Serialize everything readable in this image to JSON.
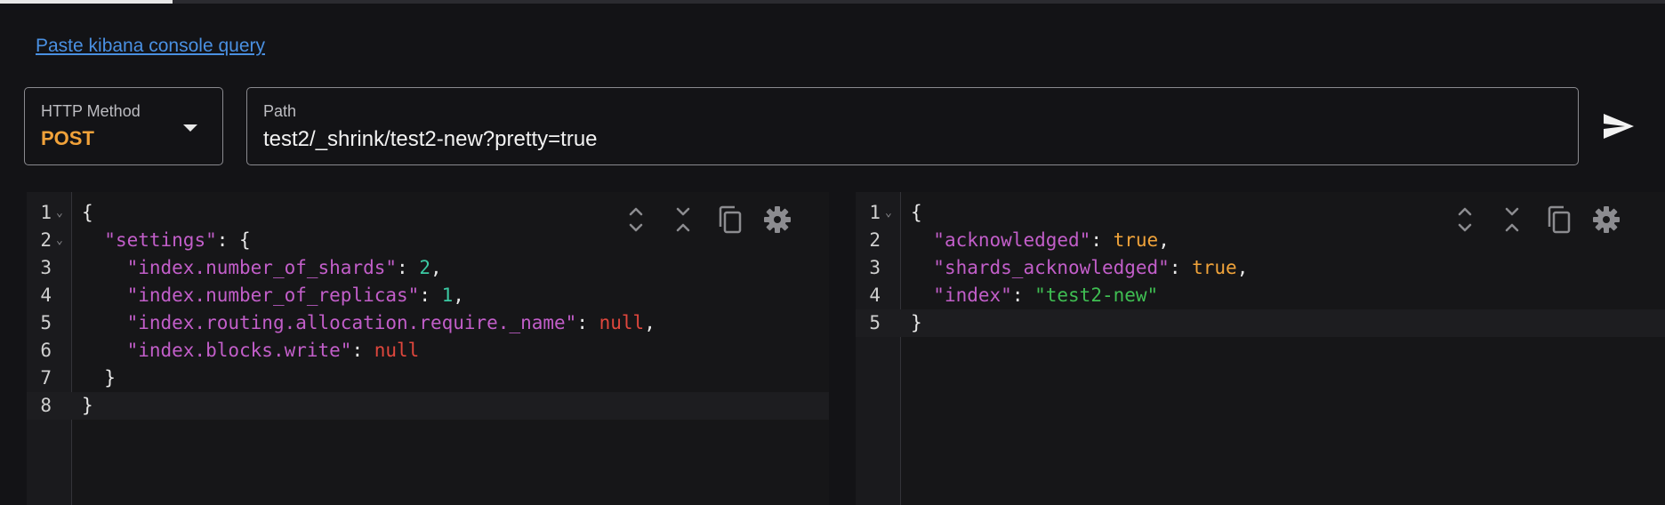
{
  "link": {
    "paste_label": "Paste kibana console query"
  },
  "method": {
    "label": "HTTP Method",
    "value": "POST"
  },
  "path": {
    "label": "Path",
    "value": "test2/_shrink/test2-new?pretty=true"
  },
  "icons": {
    "send": "send-icon",
    "expand": "expand-all-icon",
    "collapse": "collapse-all-icon",
    "copy": "copy-icon",
    "settings": "gear-icon"
  },
  "request": {
    "line_numbers": [
      "1",
      "2",
      "3",
      "4",
      "5",
      "6",
      "7",
      "8"
    ],
    "lines": [
      [
        {
          "t": "{",
          "c": "p"
        }
      ],
      [
        {
          "t": "  ",
          "c": "p"
        },
        {
          "t": "\"settings\"",
          "c": "k"
        },
        {
          "t": ": {",
          "c": "p"
        }
      ],
      [
        {
          "t": "    ",
          "c": "p"
        },
        {
          "t": "\"index.number_of_shards\"",
          "c": "k"
        },
        {
          "t": ": ",
          "c": "p"
        },
        {
          "t": "2",
          "c": "n"
        },
        {
          "t": ",",
          "c": "p"
        }
      ],
      [
        {
          "t": "    ",
          "c": "p"
        },
        {
          "t": "\"index.number_of_replicas\"",
          "c": "k"
        },
        {
          "t": ": ",
          "c": "p"
        },
        {
          "t": "1",
          "c": "n"
        },
        {
          "t": ",",
          "c": "p"
        }
      ],
      [
        {
          "t": "    ",
          "c": "p"
        },
        {
          "t": "\"index.routing.allocation.require._name\"",
          "c": "k"
        },
        {
          "t": ": ",
          "c": "p"
        },
        {
          "t": "null",
          "c": "nl"
        },
        {
          "t": ",",
          "c": "p"
        }
      ],
      [
        {
          "t": "    ",
          "c": "p"
        },
        {
          "t": "\"index.blocks.write\"",
          "c": "k"
        },
        {
          "t": ": ",
          "c": "p"
        },
        {
          "t": "null",
          "c": "nl"
        }
      ],
      [
        {
          "t": "  }",
          "c": "p"
        }
      ],
      [
        {
          "t": "}",
          "c": "p"
        }
      ]
    ],
    "fold_lines": [
      0,
      1
    ],
    "active_line": 7
  },
  "response": {
    "line_numbers": [
      "1",
      "2",
      "3",
      "4",
      "5"
    ],
    "lines": [
      [
        {
          "t": "{",
          "c": "p"
        }
      ],
      [
        {
          "t": "  ",
          "c": "p"
        },
        {
          "t": "\"acknowledged\"",
          "c": "k"
        },
        {
          "t": ": ",
          "c": "p"
        },
        {
          "t": "true",
          "c": "b"
        },
        {
          "t": ",",
          "c": "p"
        }
      ],
      [
        {
          "t": "  ",
          "c": "p"
        },
        {
          "t": "\"shards_acknowledged\"",
          "c": "k"
        },
        {
          "t": ": ",
          "c": "p"
        },
        {
          "t": "true",
          "c": "b"
        },
        {
          "t": ",",
          "c": "p"
        }
      ],
      [
        {
          "t": "  ",
          "c": "p"
        },
        {
          "t": "\"index\"",
          "c": "k"
        },
        {
          "t": ": ",
          "c": "p"
        },
        {
          "t": "\"test2-new\"",
          "c": "s"
        }
      ],
      [
        {
          "t": "}",
          "c": "p"
        }
      ]
    ],
    "fold_lines": [
      0
    ],
    "active_line": 4
  },
  "colors": {
    "background": "#131316",
    "link": "#4a90e2",
    "method": "#f1a23a",
    "key": "#c25ec9",
    "number": "#3bc9a3",
    "null": "#e0473d",
    "boolean": "#f0a33a",
    "string": "#3fbe52"
  }
}
